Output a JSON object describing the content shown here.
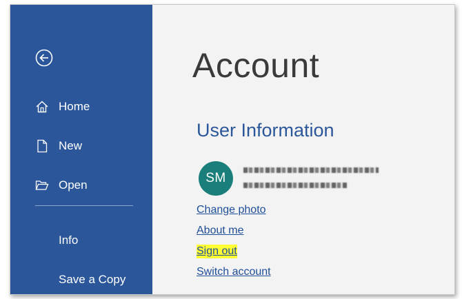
{
  "sidebar": {
    "back_icon": "arrow-left-circle-icon",
    "items": [
      {
        "label": "Home",
        "icon": "home-icon"
      },
      {
        "label": "New",
        "icon": "new-document-icon"
      },
      {
        "label": "Open",
        "icon": "open-folder-icon"
      },
      {
        "label": "Info"
      },
      {
        "label": "Save a Copy"
      }
    ]
  },
  "main": {
    "title": "Account",
    "user_info": {
      "heading": "User Information",
      "avatar_initials": "SM",
      "links": {
        "change_photo": "Change photo",
        "about_me": "About me",
        "sign_out": "Sign out",
        "switch_account": "Switch account"
      }
    }
  },
  "colors": {
    "sidebar_bg": "#2b579a",
    "avatar_bg": "#1a7f7a",
    "highlight": "#ffff33",
    "link": "#1f4e99"
  }
}
